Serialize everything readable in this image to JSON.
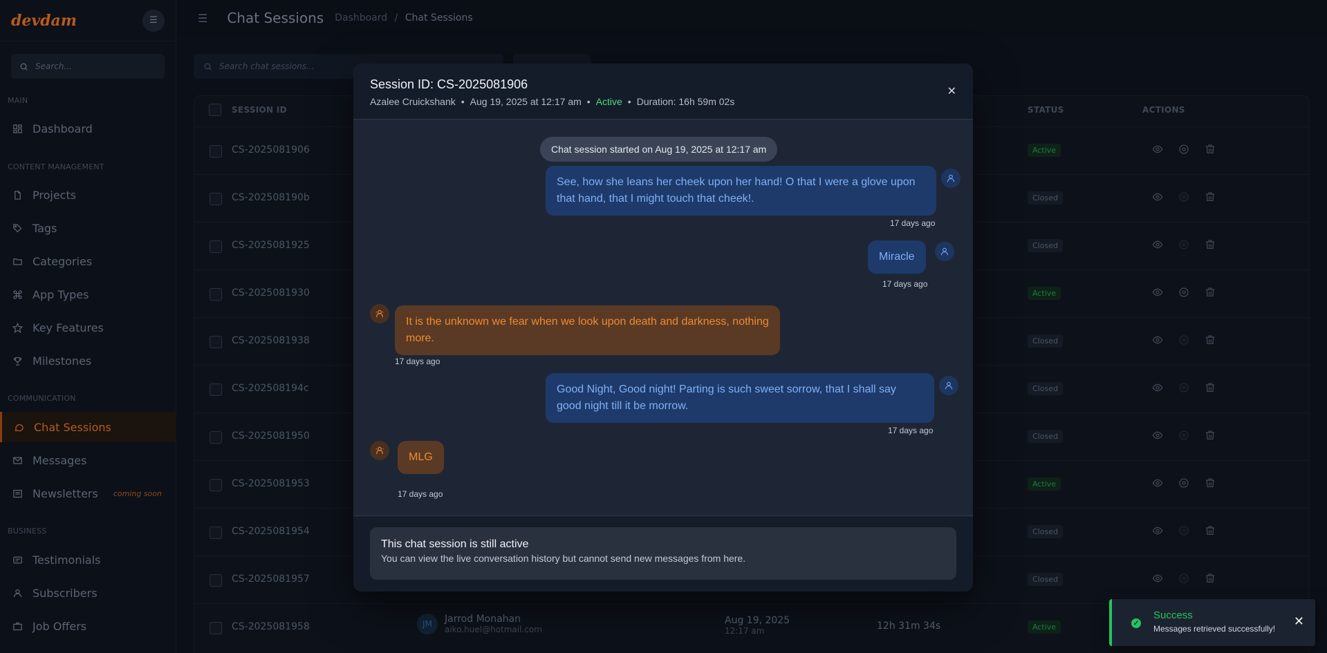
{
  "sidebar": {
    "logo": "devdam",
    "search_placeholder": "Search...",
    "sections": {
      "main": "MAIN",
      "content": "CONTENT MANAGEMENT",
      "communication": "COMMUNICATION",
      "business": "BUSINESS"
    },
    "items": {
      "dashboard": "Dashboard",
      "projects": "Projects",
      "tags": "Tags",
      "categories": "Categories",
      "app_types": "App Types",
      "key_features": "Key Features",
      "milestones": "Milestones",
      "chat_sessions": "Chat Sessions",
      "messages": "Messages",
      "newsletters": "Newsletters",
      "newsletters_badge": "coming soon",
      "testimonials": "Testimonials",
      "subscribers": "Subscribers",
      "job_offers": "Job Offers"
    }
  },
  "header": {
    "title": "Chat Sessions",
    "breadcrumb_root": "Dashboard",
    "breadcrumb_sep": "/",
    "breadcrumb_current": "Chat Sessions"
  },
  "main": {
    "search_placeholder": "Search chat sessions...",
    "columns": {
      "session_id": "SESSION ID",
      "status": "STATUS",
      "actions": "ACTIONS"
    },
    "rows": [
      {
        "id": "CS-2025081906",
        "status": "Active"
      },
      {
        "id": "CS-202508190b",
        "status": "Closed"
      },
      {
        "id": "CS-2025081925",
        "status": "Closed"
      },
      {
        "id": "CS-2025081930",
        "status": "Active"
      },
      {
        "id": "CS-2025081938",
        "status": "Closed"
      },
      {
        "id": "CS-202508194c",
        "status": "Closed"
      },
      {
        "id": "CS-2025081950",
        "status": "Closed"
      },
      {
        "id": "CS-2025081953",
        "status": "Active"
      },
      {
        "id": "CS-2025081954",
        "status": "Closed"
      },
      {
        "id": "CS-2025081957",
        "status": "Closed"
      },
      {
        "id": "CS-2025081958",
        "status": "Active",
        "initials": "JM",
        "name": "Jarrod Monahan",
        "email": "aiko.huel@hotmail.com",
        "date": "Aug 19, 2025",
        "time": "12:17 am",
        "duration": "12h 31m 34s"
      }
    ]
  },
  "modal": {
    "title": "Session ID: CS-2025081906",
    "user": "Azalee Cruickshank",
    "date": "Aug 19, 2025 at 12:17 am",
    "status": "Active",
    "duration": "Duration: 16h 59m 02s",
    "close_label": "✕",
    "system_message": "Chat session started on Aug 19, 2025 at 12:17 am",
    "messages": [
      {
        "text": "See, how she leans her cheek upon her hand! O that I were a glove upon that hand, that I might touch that cheek!.",
        "time": "17 days ago"
      },
      {
        "text": "Miracle",
        "time": "17 days ago"
      },
      {
        "text": "It is the unknown we fear when we look upon death and darkness, nothing more.",
        "time": "17 days ago"
      },
      {
        "text": "Good Night, Good night! Parting is such sweet sorrow, that I shall say good night till it be morrow.",
        "time": "17 days ago"
      },
      {
        "text": "MLG",
        "time": "17 days ago"
      }
    ],
    "notice_title": "This chat session is still active",
    "notice_sub": "You can view the live conversation history but cannot send new messages from here."
  },
  "toast": {
    "title": "Success",
    "message": "Messages retrieved successfully!",
    "close": "✕"
  },
  "colors": {
    "accent": "#b85a1c",
    "user_bubble": "#1e3a6b",
    "agent_bubble": "#5a3a25",
    "success": "#22c55e"
  }
}
